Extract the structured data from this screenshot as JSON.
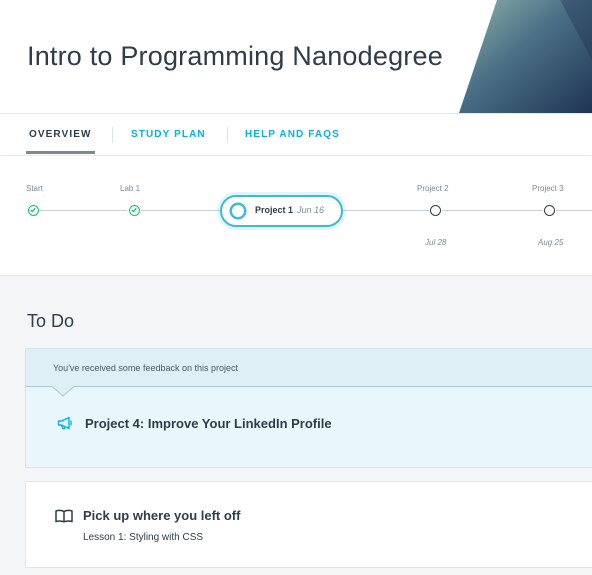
{
  "header": {
    "title": "Intro to Programming Nanodegree"
  },
  "tabs": [
    {
      "label": "OVERVIEW",
      "active": true
    },
    {
      "label": "STUDY PLAN",
      "active": false
    },
    {
      "label": "HELP AND FAQS",
      "active": false
    }
  ],
  "timeline": {
    "milestones": [
      {
        "label": "Start",
        "status": "complete",
        "date": ""
      },
      {
        "label": "Lab 1",
        "status": "complete",
        "date": ""
      },
      {
        "label": "Project 1",
        "status": "current",
        "date": "Jun 16"
      },
      {
        "label": "Project 2",
        "status": "upcoming",
        "date": "Jul 28"
      },
      {
        "label": "Project 3",
        "status": "upcoming",
        "date": "Aug 25"
      }
    ]
  },
  "todo": {
    "heading": "To Do",
    "feedback_card": {
      "message": "You've received some feedback on this project",
      "project_title": "Project 4: Improve Your LinkedIn Profile",
      "icon": "megaphone-icon"
    },
    "resume_card": {
      "title": "Pick up where you left off",
      "lesson": "Lesson 1: Styling with CSS",
      "icon": "open-book-icon"
    }
  },
  "colors": {
    "accent": "#02b3e4",
    "complete": "#15c26b",
    "text": "#2e3d49",
    "header_art_light": "#7fa7a8",
    "header_art_dark": "#233a57"
  }
}
